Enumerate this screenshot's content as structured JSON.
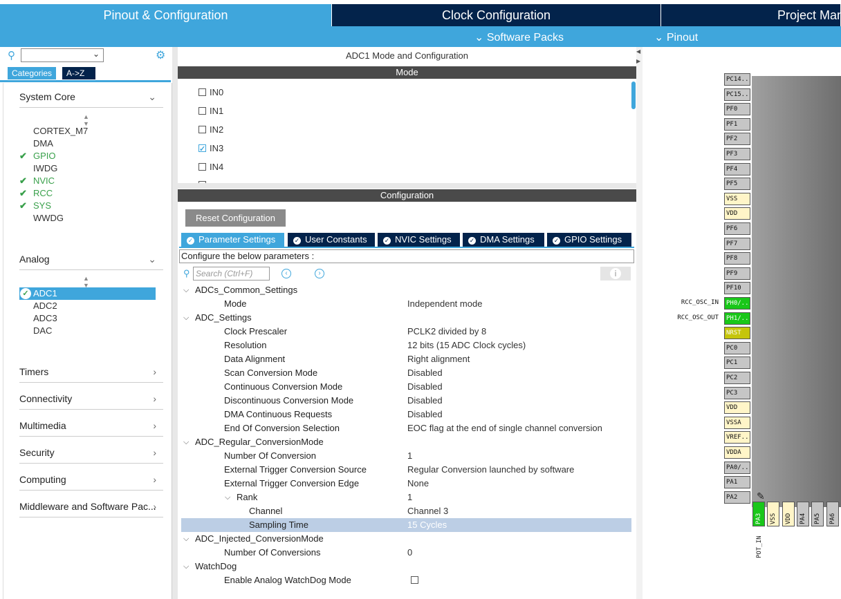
{
  "top_tabs": [
    {
      "label": "Pinout & Configuration",
      "active": true
    },
    {
      "label": "Clock Configuration",
      "active": false
    },
    {
      "label": "Project Manager",
      "active": false
    }
  ],
  "sub_bar": {
    "software_packs": "Software Packs",
    "pinout": "Pinout"
  },
  "left": {
    "tab_categories": "Categories",
    "tab_az": "A->Z",
    "system_core": {
      "title": "System Core",
      "items": [
        {
          "label": "CORTEX_M7",
          "ok": false
        },
        {
          "label": "DMA",
          "ok": false
        },
        {
          "label": "GPIO",
          "ok": true
        },
        {
          "label": "IWDG",
          "ok": false
        },
        {
          "label": "NVIC",
          "ok": true
        },
        {
          "label": "RCC",
          "ok": true
        },
        {
          "label": "SYS",
          "ok": true
        },
        {
          "label": "WWDG",
          "ok": false
        }
      ]
    },
    "analog": {
      "title": "Analog",
      "items": [
        {
          "label": "ADC1",
          "ok": true,
          "selected": true
        },
        {
          "label": "ADC2",
          "ok": false
        },
        {
          "label": "ADC3",
          "ok": false
        },
        {
          "label": "DAC",
          "ok": false
        }
      ]
    },
    "categories": [
      "Timers",
      "Connectivity",
      "Multimedia",
      "Security",
      "Computing",
      "Middleware and Software Pac..."
    ]
  },
  "middle": {
    "title": "ADC1 Mode and Configuration",
    "mode_header": "Mode",
    "mode_inputs": [
      {
        "label": "IN0",
        "checked": false
      },
      {
        "label": "IN1",
        "checked": false
      },
      {
        "label": "IN2",
        "checked": false
      },
      {
        "label": "IN3",
        "checked": true
      },
      {
        "label": "IN4",
        "checked": false
      }
    ],
    "config_header": "Configuration",
    "reset_button": "Reset Configuration",
    "tabs": [
      "Parameter Settings",
      "User Constants",
      "NVIC Settings",
      "DMA Settings",
      "GPIO Settings"
    ],
    "description": "Configure the below parameters :",
    "search_placeholder": "Search (Ctrl+F)",
    "params": [
      {
        "name": "ADCs_Common_Settings",
        "value": "",
        "level": 0,
        "group": true
      },
      {
        "name": "Mode",
        "value": "Independent mode",
        "level": 1
      },
      {
        "name": "ADC_Settings",
        "value": "",
        "level": 0,
        "group": true
      },
      {
        "name": "Clock Prescaler",
        "value": "PCLK2 divided by 8",
        "level": 1
      },
      {
        "name": "Resolution",
        "value": "12 bits (15 ADC Clock cycles)",
        "level": 1
      },
      {
        "name": "Data Alignment",
        "value": "Right alignment",
        "level": 1
      },
      {
        "name": "Scan Conversion Mode",
        "value": "Disabled",
        "level": 1
      },
      {
        "name": "Continuous Conversion Mode",
        "value": "Disabled",
        "level": 1
      },
      {
        "name": "Discontinuous Conversion Mode",
        "value": "Disabled",
        "level": 1
      },
      {
        "name": "DMA Continuous Requests",
        "value": "Disabled",
        "level": 1
      },
      {
        "name": "End Of Conversion Selection",
        "value": "EOC flag at the end of single channel conversion",
        "level": 1
      },
      {
        "name": "ADC_Regular_ConversionMode",
        "value": "",
        "level": 0,
        "group": true
      },
      {
        "name": "Number Of Conversion",
        "value": "1",
        "level": 1
      },
      {
        "name": "External Trigger Conversion Source",
        "value": "Regular Conversion launched by software",
        "level": 1
      },
      {
        "name": "External Trigger Conversion Edge",
        "value": "None",
        "level": 1
      },
      {
        "name": "Rank",
        "value": "1",
        "level": 2,
        "group": true
      },
      {
        "name": "Channel",
        "value": "Channel 3",
        "level": 3
      },
      {
        "name": "Sampling Time",
        "value": "15 Cycles",
        "level": 3,
        "selected": true
      },
      {
        "name": "ADC_Injected_ConversionMode",
        "value": "",
        "level": 0,
        "group": true
      },
      {
        "name": "Number Of Conversions",
        "value": "0",
        "level": 1
      },
      {
        "name": "WatchDog",
        "value": "",
        "level": 0,
        "group": true
      },
      {
        "name": "Enable Analog WatchDog Mode",
        "value": "",
        "level": 1,
        "checkbox": true
      }
    ]
  },
  "chip": {
    "left_pins": [
      {
        "label": "PC14..",
        "color": "grey"
      },
      {
        "label": "PC15..",
        "color": "grey"
      },
      {
        "label": "PF0",
        "color": "grey"
      },
      {
        "label": "PF1",
        "color": "grey"
      },
      {
        "label": "PF2",
        "color": "grey"
      },
      {
        "label": "PF3",
        "color": "grey"
      },
      {
        "label": "PF4",
        "color": "grey"
      },
      {
        "label": "PF5",
        "color": "grey"
      },
      {
        "label": "VSS",
        "color": "yellow"
      },
      {
        "label": "VDD",
        "color": "yellow"
      },
      {
        "label": "PF6",
        "color": "grey"
      },
      {
        "label": "PF7",
        "color": "grey"
      },
      {
        "label": "PF8",
        "color": "grey"
      },
      {
        "label": "PF9",
        "color": "grey"
      },
      {
        "label": "PF10",
        "color": "grey"
      },
      {
        "label": "PH0/..",
        "color": "green",
        "signal": "RCC_OSC_IN"
      },
      {
        "label": "PH1/..",
        "color": "green",
        "signal": "RCC_OSC_OUT"
      },
      {
        "label": "NRST",
        "color": "olive"
      },
      {
        "label": "PC0",
        "color": "grey"
      },
      {
        "label": "PC1",
        "color": "grey"
      },
      {
        "label": "PC2",
        "color": "grey"
      },
      {
        "label": "PC3",
        "color": "grey"
      },
      {
        "label": "VDD",
        "color": "yellow"
      },
      {
        "label": "VSSA",
        "color": "yellow"
      },
      {
        "label": "VREF..",
        "color": "yellow"
      },
      {
        "label": "VDDA",
        "color": "yellow"
      },
      {
        "label": "PA0/..",
        "color": "grey"
      },
      {
        "label": "PA1",
        "color": "grey"
      },
      {
        "label": "PA2",
        "color": "grey"
      }
    ],
    "bottom_pins": [
      {
        "label": "PA3",
        "color": "green"
      },
      {
        "label": "VSS",
        "color": "yellow"
      },
      {
        "label": "VDD",
        "color": "yellow"
      },
      {
        "label": "PA4",
        "color": "grey"
      },
      {
        "label": "PA5",
        "color": "grey"
      },
      {
        "label": "PA6",
        "color": "grey"
      }
    ],
    "pa3_signal": "POT_IN"
  }
}
